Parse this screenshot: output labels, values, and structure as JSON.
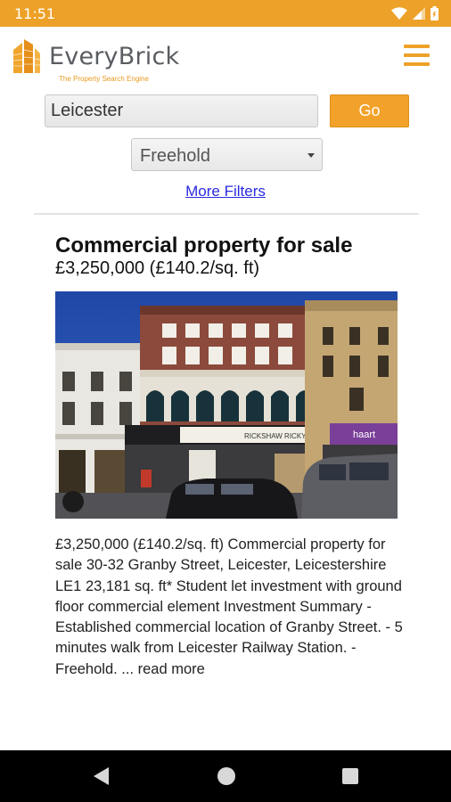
{
  "status_bar": {
    "time": "11:51",
    "icons": [
      "wifi-icon",
      "cell-signal-icon",
      "battery-icon"
    ],
    "color": "#eda128"
  },
  "header": {
    "brand_name": "EveryBrick",
    "tagline": "The Property Search Engine",
    "menu_icon": "hamburger-menu-icon",
    "accent_color": "#eda128"
  },
  "search": {
    "location_value": "Leicester",
    "go_label": "Go",
    "tenure_selected": "Freehold",
    "more_filters_label": "More Filters"
  },
  "listing": {
    "title": "Commercial property for sale",
    "price": "£3,250,000 (£140.2/sq. ft)",
    "description": "£3,250,000 (£140.2/sq. ft) Commercial property for sale 30-32 Granby Street, Leicester, Leicestershire LE1 23,181 sq. ft* Student let investment with ground floor commercial element Investment Summary - Established commercial location of Granby Street. - 5 minutes walk from Leicester Railway Station. - Freehold. ...",
    "read_more_label": "read more",
    "photo_signs": {
      "restaurant_sign": "RICKSHAW RICKY",
      "shop_sign": "haart"
    }
  },
  "nav_bar": {
    "icons": [
      "back-icon",
      "home-icon",
      "recents-icon"
    ]
  }
}
